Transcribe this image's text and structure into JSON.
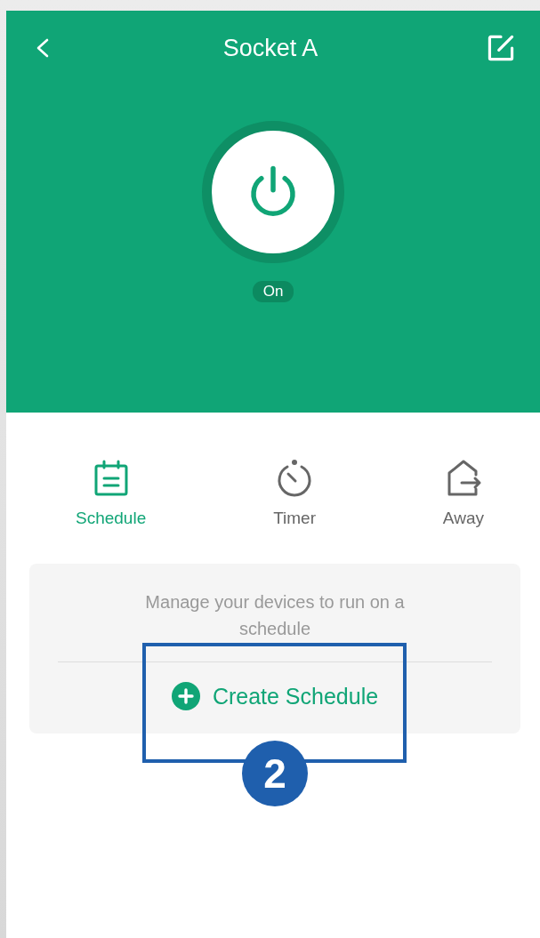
{
  "header": {
    "title": "Socket A"
  },
  "power": {
    "on": true,
    "status": "On"
  },
  "tabs": [
    {
      "label": "Schedule",
      "kind": "schedule",
      "selected": true
    },
    {
      "label": "Timer",
      "kind": "timer",
      "selected": false
    },
    {
      "label": "Away",
      "kind": "away",
      "selected": false
    }
  ],
  "empty_state": {
    "message": "Manage your devices to run on a schedule",
    "action": "Create Schedule"
  },
  "annotation": {
    "label": "2"
  }
}
